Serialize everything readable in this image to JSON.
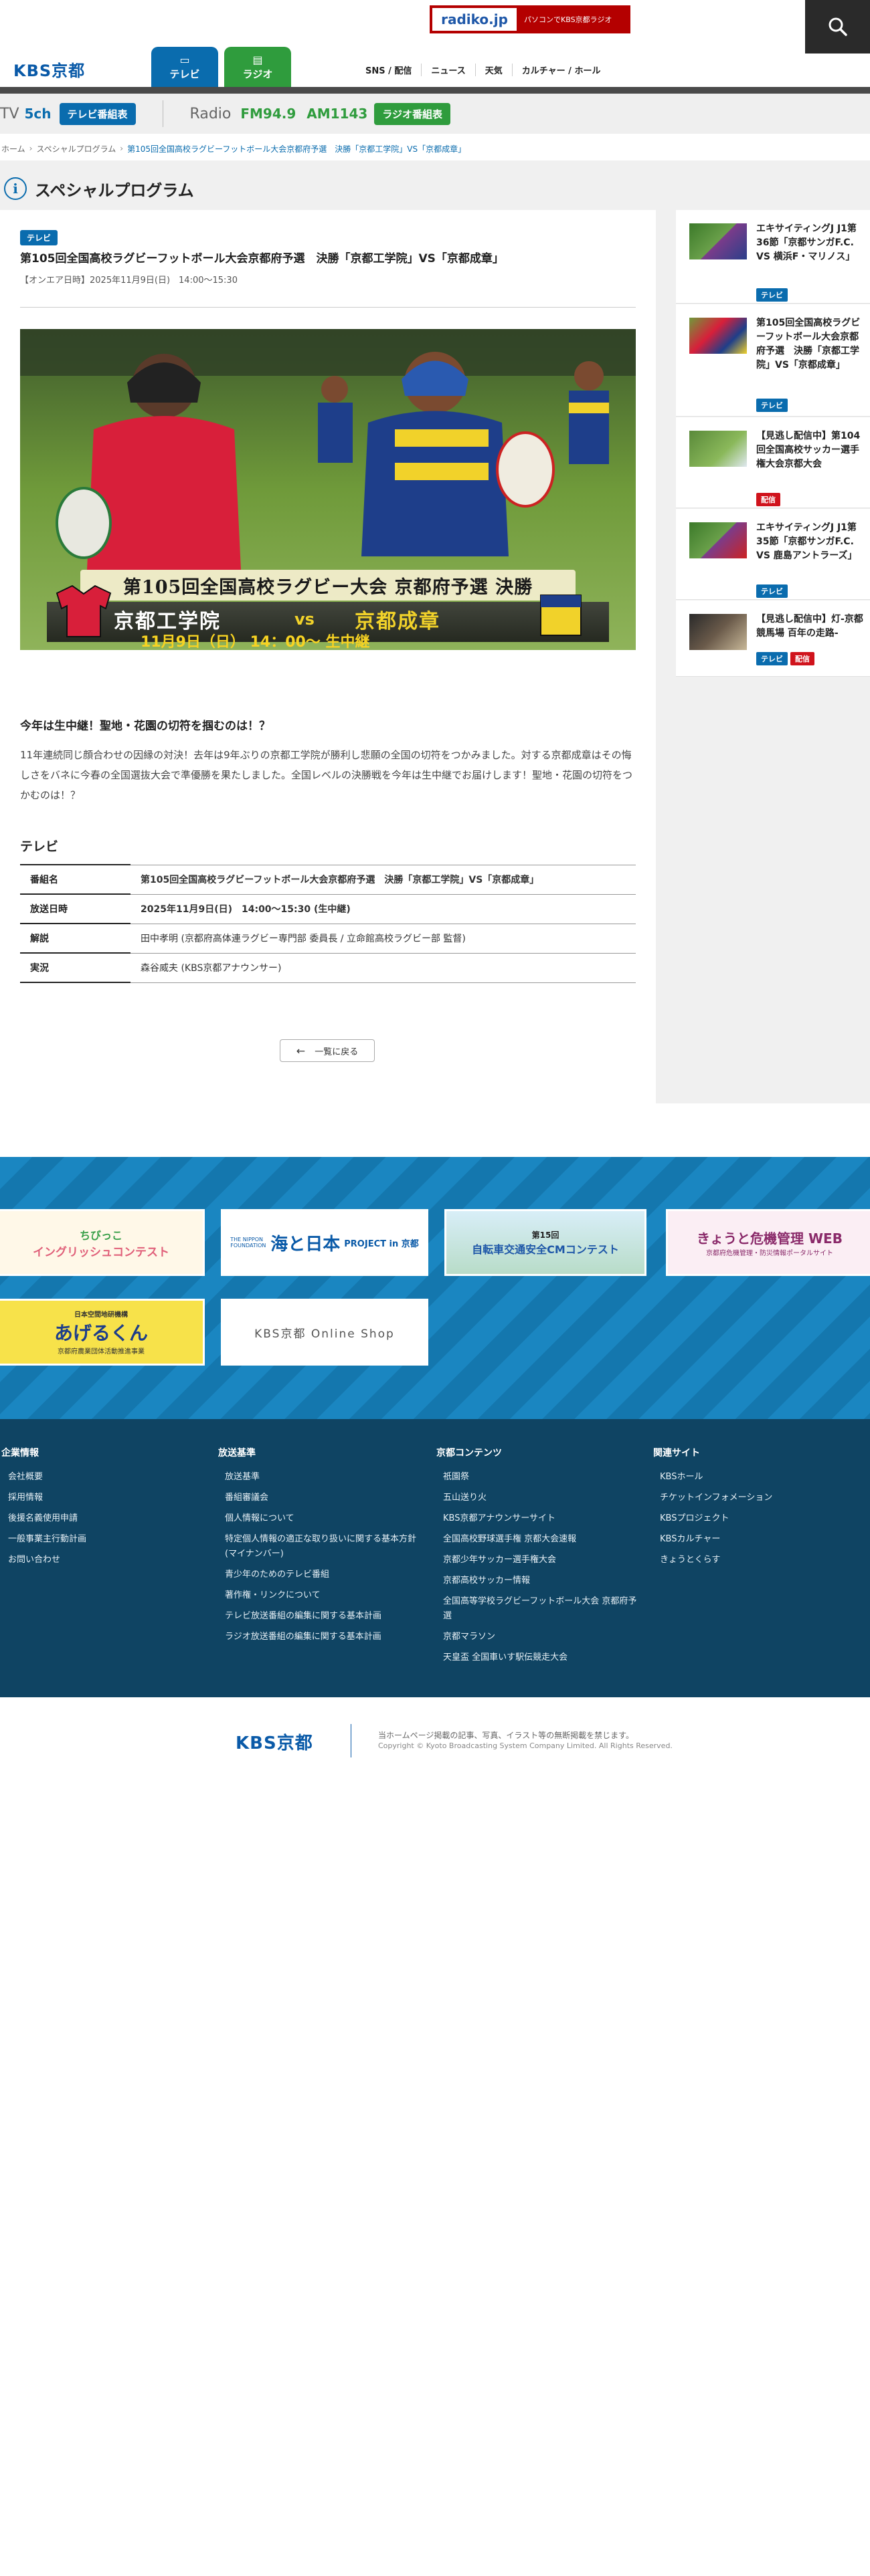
{
  "header": {
    "radiko_logo": "radiko.jp",
    "radiko_text": "パソコンでKBS京都ラジオ",
    "site_logo": "KBS京都",
    "tabs": [
      {
        "label": "テレビ"
      },
      {
        "label": "ラジオ"
      }
    ],
    "nav": [
      "SNS / 配信",
      "ニュース",
      "天気",
      "カルチャー / ホール"
    ]
  },
  "channels": {
    "tv_label": "TV",
    "tv_channel": "5ch",
    "tv_guide": "テレビ番組表",
    "radio_label": "Radio",
    "fm": "FM94.9",
    "am": "AM1143",
    "radio_guide": "ラジオ番組表"
  },
  "breadcrumb": [
    "ホーム",
    "スペシャルプログラム",
    "第105回全国高校ラグビーフットボール大会京都府予選　決勝「京都工学院」VS「京都成章」"
  ],
  "page_title": "スペシャルプログラム",
  "article": {
    "tag": "テレビ",
    "title": "第105回全国高校ラグビーフットボール大会京都府予選　決勝「京都工学院」VS「京都成章」",
    "onair": "【オンエア日時】2025年11月9日(日)　14:00〜15:30",
    "hero": {
      "headline": "第105回全国高校ラグビー大会 京都府予選 決勝",
      "team1": "京都工学院",
      "vs": "vs",
      "team2": "京都成章",
      "datetime": "11月9日（日） 14：00〜 生中継",
      "jersey": "工学院"
    },
    "subhead": "今年は生中継！聖地・花園の切符を掴むのは！？",
    "body": "11年連続同じ顔合わせの因縁の対決！去年は9年ぶりの京都工学院が勝利し悲願の全国の切符をつかみました。対する京都成章はその悔しさをバネに今春の全国選抜大会で準優勝を果たしました。全国レベルの決勝戦を今年は生中継でお届けします！聖地・花園の切符をつかむのは！？",
    "section": "テレビ",
    "table": [
      {
        "label": "番組名",
        "value": "第105回全国高校ラグビーフットボール大会京都府予選　決勝「京都工学院」VS「京都成章」",
        "bold": true
      },
      {
        "label": "放送日時",
        "value": "2025年11月9日(日)　14:00〜15:30 (生中継)",
        "bold": true
      },
      {
        "label": "解説",
        "value": "田中孝明 (京都府高体連ラグビー専門部 委員長 / 立命館高校ラグビー部 監督)",
        "bold": false
      },
      {
        "label": "実況",
        "value": "森谷威夫 (KBS京都アナウンサー)",
        "bold": false
      }
    ],
    "back_label": "一覧に戻る"
  },
  "sidebar": [
    {
      "title": "エキサイティングJ J1第36節「京都サンガF.C. VS 横浜F・マリノス」",
      "tags": [
        {
          "label": "テレビ",
          "color": "#0a6cae"
        }
      ]
    },
    {
      "title": "第105回全国高校ラグビーフットボール大会京都府予選　決勝「京都工学院」VS「京都成章」",
      "tags": [
        {
          "label": "テレビ",
          "color": "#0a6cae"
        }
      ]
    },
    {
      "title": "【見逃し配信中】第104回全国高校サッカー選手権大会京都大会",
      "tags": [
        {
          "label": "配信",
          "color": "#d0131c"
        }
      ]
    },
    {
      "title": "エキサイティングJ J1第35節「京都サンガF.C. VS 鹿島アントラーズ」",
      "tags": [
        {
          "label": "テレビ",
          "color": "#0a6cae"
        }
      ]
    },
    {
      "title": "【見逃し配信中】灯-京都競馬場 百年の走路-",
      "tags": [
        {
          "label": "テレビ",
          "color": "#0a6cae"
        },
        {
          "label": "配信",
          "color": "#d0131c"
        }
      ]
    }
  ],
  "banners": [
    {
      "line1": "ちびっこ",
      "line2": "イングリッシュコンテスト"
    },
    {
      "line1": "海と日本",
      "line2": "PROJECT in 京都",
      "small": "THE NIPPON FOUNDATION"
    },
    {
      "line1": "第15回",
      "line2": "自転車交通安全CMコンテスト"
    },
    {
      "line1": "きょうと危機管理 WEB",
      "line2": "京都府危機管理・防災情報ポータルサイト"
    },
    {
      "line1": "日本空間地研機構",
      "line2": "あげるくん",
      "small": "京都府農業団体活動推進事業"
    },
    {
      "line1": "KBS京都 Online Shop"
    }
  ],
  "footer_nav": [
    {
      "heading": "企業情報",
      "links": [
        "会社概要",
        "採用情報",
        "後援名義使用申請",
        "一般事業主行動計画",
        "お問い合わせ"
      ]
    },
    {
      "heading": "放送基準",
      "links": [
        "放送基準",
        "番組審議会",
        "個人情報について",
        "特定個人情報の適正な取り扱いに関する基本方針(マイナンバー)",
        "青少年のためのテレビ番組",
        "著作権・リンクについて",
        "テレビ放送番組の編集に関する基本計画",
        "ラジオ放送番組の編集に関する基本計画"
      ]
    },
    {
      "heading": "京都コンテンツ",
      "links": [
        "祇園祭",
        "五山送り火",
        "KBS京都アナウンサーサイト",
        "全国高校野球選手権 京都大会速報",
        "京都少年サッカー選手権大会",
        "京都高校サッカー情報",
        "全国高等学校ラグビーフットボール大会 京都府予選",
        "京都マラソン",
        "天皇盃 全国車いす駅伝競走大会"
      ]
    },
    {
      "heading": "関連サイト",
      "links": [
        "KBSホール",
        "チケットインフォメーション",
        "KBSプロジェクト",
        "KBSカルチャー",
        "きょうとくらす"
      ]
    }
  ],
  "footer": {
    "logo": "KBS京都",
    "copy1": "当ホームページ掲載の記事、写真、イラスト等の無断掲載を禁じます。",
    "copy2": "Copyright © Kyoto Broadcasting System Company Limited. All Rights Reserved."
  },
  "colors": {
    "tv_blue": "#0a6cae",
    "radio_green": "#2f9c3d",
    "footer_navy": "#0f4463",
    "banner_blue": "#1a86c1",
    "live_red": "#d0131c"
  }
}
